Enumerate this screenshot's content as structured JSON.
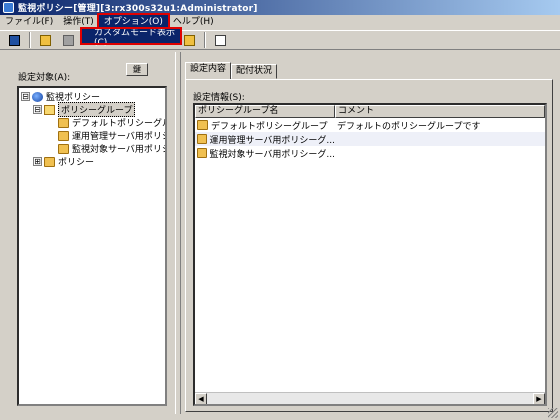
{
  "window": {
    "title": "監視ポリシー[管理][3:rx300s32u1:Administrator]"
  },
  "menubar": {
    "items": [
      {
        "label": "ファイル(F)"
      },
      {
        "label": "操作(T)"
      },
      {
        "label": "オプション(O)"
      },
      {
        "label": "ヘルプ(H)"
      }
    ]
  },
  "dropdown": {
    "item": "カスタムモード表示(C)"
  },
  "toolbar": {
    "icons": [
      "policy-icon",
      "folder-icon",
      "copy-icon",
      "open-folder-icon",
      "window-icon"
    ]
  },
  "left": {
    "label": "設定対象(A):",
    "lock_button": "鍵"
  },
  "tree": {
    "root": {
      "label": "監視ポリシー",
      "expander": "⊟"
    },
    "group": {
      "label": "ポリシーグループ",
      "expander": "⊟"
    },
    "children": [
      {
        "label": "デフォルトポリシーグル"
      },
      {
        "label": "運用管理サーバ用ポリシ"
      },
      {
        "label": "監視対象サーバ用ポリシ"
      }
    ],
    "policy": {
      "label": "ポリシー",
      "expander": "⊞"
    }
  },
  "tabs": [
    {
      "label": "設定内容"
    },
    {
      "label": "配付状況"
    }
  ],
  "settings": {
    "label": "設定情報(S):",
    "columns": [
      "ポリシーグループ名",
      "コメント"
    ],
    "rows": [
      {
        "name": "デフォルトポリシーグループ",
        "comment": "デフォルトのポリシーグループです"
      },
      {
        "name": "運用管理サーバ用ポリシーグ...",
        "comment": ""
      },
      {
        "name": "監視対象サーバ用ポリシーグ...",
        "comment": ""
      }
    ]
  },
  "colors": {
    "titlebar_start": "#0a246a",
    "titlebar_end": "#a6caf0",
    "highlight": "#e00000",
    "face": "#d4d0c8"
  }
}
